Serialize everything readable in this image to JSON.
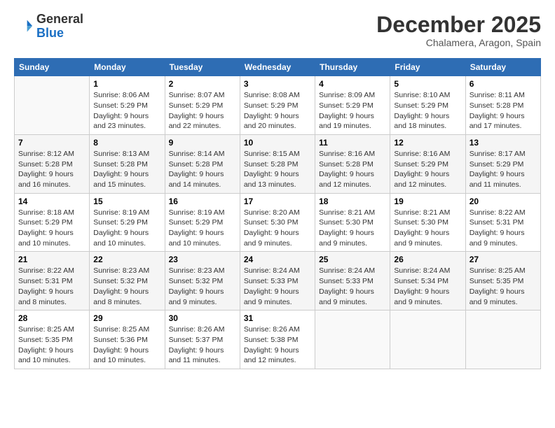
{
  "header": {
    "logo_line1": "General",
    "logo_line2": "Blue",
    "month": "December 2025",
    "location": "Chalamera, Aragon, Spain"
  },
  "days_of_week": [
    "Sunday",
    "Monday",
    "Tuesday",
    "Wednesday",
    "Thursday",
    "Friday",
    "Saturday"
  ],
  "weeks": [
    [
      {
        "day": "",
        "info": ""
      },
      {
        "day": "1",
        "info": "Sunrise: 8:06 AM\nSunset: 5:29 PM\nDaylight: 9 hours\nand 23 minutes."
      },
      {
        "day": "2",
        "info": "Sunrise: 8:07 AM\nSunset: 5:29 PM\nDaylight: 9 hours\nand 22 minutes."
      },
      {
        "day": "3",
        "info": "Sunrise: 8:08 AM\nSunset: 5:29 PM\nDaylight: 9 hours\nand 20 minutes."
      },
      {
        "day": "4",
        "info": "Sunrise: 8:09 AM\nSunset: 5:29 PM\nDaylight: 9 hours\nand 19 minutes."
      },
      {
        "day": "5",
        "info": "Sunrise: 8:10 AM\nSunset: 5:29 PM\nDaylight: 9 hours\nand 18 minutes."
      },
      {
        "day": "6",
        "info": "Sunrise: 8:11 AM\nSunset: 5:28 PM\nDaylight: 9 hours\nand 17 minutes."
      }
    ],
    [
      {
        "day": "7",
        "info": "Sunrise: 8:12 AM\nSunset: 5:28 PM\nDaylight: 9 hours\nand 16 minutes."
      },
      {
        "day": "8",
        "info": "Sunrise: 8:13 AM\nSunset: 5:28 PM\nDaylight: 9 hours\nand 15 minutes."
      },
      {
        "day": "9",
        "info": "Sunrise: 8:14 AM\nSunset: 5:28 PM\nDaylight: 9 hours\nand 14 minutes."
      },
      {
        "day": "10",
        "info": "Sunrise: 8:15 AM\nSunset: 5:28 PM\nDaylight: 9 hours\nand 13 minutes."
      },
      {
        "day": "11",
        "info": "Sunrise: 8:16 AM\nSunset: 5:28 PM\nDaylight: 9 hours\nand 12 minutes."
      },
      {
        "day": "12",
        "info": "Sunrise: 8:16 AM\nSunset: 5:29 PM\nDaylight: 9 hours\nand 12 minutes."
      },
      {
        "day": "13",
        "info": "Sunrise: 8:17 AM\nSunset: 5:29 PM\nDaylight: 9 hours\nand 11 minutes."
      }
    ],
    [
      {
        "day": "14",
        "info": "Sunrise: 8:18 AM\nSunset: 5:29 PM\nDaylight: 9 hours\nand 10 minutes."
      },
      {
        "day": "15",
        "info": "Sunrise: 8:19 AM\nSunset: 5:29 PM\nDaylight: 9 hours\nand 10 minutes."
      },
      {
        "day": "16",
        "info": "Sunrise: 8:19 AM\nSunset: 5:29 PM\nDaylight: 9 hours\nand 10 minutes."
      },
      {
        "day": "17",
        "info": "Sunrise: 8:20 AM\nSunset: 5:30 PM\nDaylight: 9 hours\nand 9 minutes."
      },
      {
        "day": "18",
        "info": "Sunrise: 8:21 AM\nSunset: 5:30 PM\nDaylight: 9 hours\nand 9 minutes."
      },
      {
        "day": "19",
        "info": "Sunrise: 8:21 AM\nSunset: 5:30 PM\nDaylight: 9 hours\nand 9 minutes."
      },
      {
        "day": "20",
        "info": "Sunrise: 8:22 AM\nSunset: 5:31 PM\nDaylight: 9 hours\nand 9 minutes."
      }
    ],
    [
      {
        "day": "21",
        "info": "Sunrise: 8:22 AM\nSunset: 5:31 PM\nDaylight: 9 hours\nand 8 minutes."
      },
      {
        "day": "22",
        "info": "Sunrise: 8:23 AM\nSunset: 5:32 PM\nDaylight: 9 hours\nand 8 minutes."
      },
      {
        "day": "23",
        "info": "Sunrise: 8:23 AM\nSunset: 5:32 PM\nDaylight: 9 hours\nand 9 minutes."
      },
      {
        "day": "24",
        "info": "Sunrise: 8:24 AM\nSunset: 5:33 PM\nDaylight: 9 hours\nand 9 minutes."
      },
      {
        "day": "25",
        "info": "Sunrise: 8:24 AM\nSunset: 5:33 PM\nDaylight: 9 hours\nand 9 minutes."
      },
      {
        "day": "26",
        "info": "Sunrise: 8:24 AM\nSunset: 5:34 PM\nDaylight: 9 hours\nand 9 minutes."
      },
      {
        "day": "27",
        "info": "Sunrise: 8:25 AM\nSunset: 5:35 PM\nDaylight: 9 hours\nand 9 minutes."
      }
    ],
    [
      {
        "day": "28",
        "info": "Sunrise: 8:25 AM\nSunset: 5:35 PM\nDaylight: 9 hours\nand 10 minutes."
      },
      {
        "day": "29",
        "info": "Sunrise: 8:25 AM\nSunset: 5:36 PM\nDaylight: 9 hours\nand 10 minutes."
      },
      {
        "day": "30",
        "info": "Sunrise: 8:26 AM\nSunset: 5:37 PM\nDaylight: 9 hours\nand 11 minutes."
      },
      {
        "day": "31",
        "info": "Sunrise: 8:26 AM\nSunset: 5:38 PM\nDaylight: 9 hours\nand 12 minutes."
      },
      {
        "day": "",
        "info": ""
      },
      {
        "day": "",
        "info": ""
      },
      {
        "day": "",
        "info": ""
      }
    ]
  ]
}
